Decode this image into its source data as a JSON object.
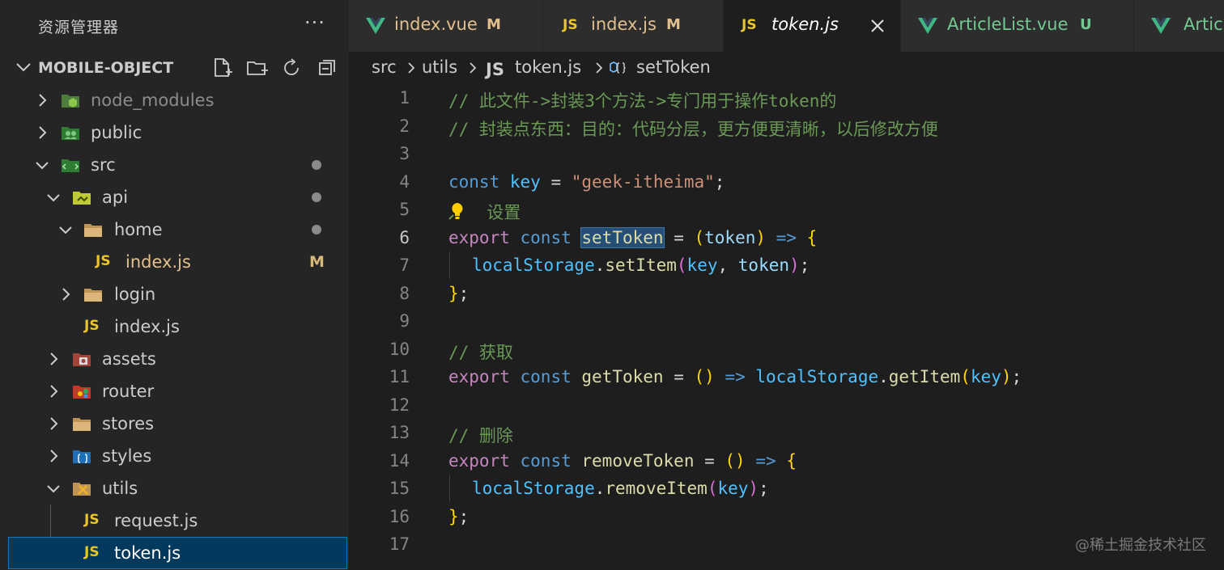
{
  "explorer": {
    "title": "资源管理器",
    "more": "···",
    "project": "MOBILE-OBJECT",
    "tree": [
      {
        "label": "node_modules",
        "depth": 1,
        "expanded": false,
        "icon": "node-folder-icon"
      },
      {
        "label": "public",
        "depth": 1,
        "expanded": false,
        "icon": "public-folder-icon"
      },
      {
        "label": "src",
        "depth": 1,
        "expanded": true,
        "icon": "src-folder-icon",
        "dot": true
      },
      {
        "label": "api",
        "depth": 2,
        "expanded": true,
        "icon": "api-folder-icon",
        "dot": true
      },
      {
        "label": "home",
        "depth": 3,
        "expanded": true,
        "icon": "folder-icon",
        "dot": true
      },
      {
        "label": "index.js",
        "depth": 4,
        "icon": "js-file-icon",
        "badge": "M"
      },
      {
        "label": "login",
        "depth": 3,
        "expanded": false,
        "icon": "folder-icon"
      },
      {
        "label": "index.js",
        "depth": 3,
        "icon": "js-file-icon"
      },
      {
        "label": "assets",
        "depth": 2,
        "expanded": false,
        "icon": "assets-folder-icon"
      },
      {
        "label": "router",
        "depth": 2,
        "expanded": false,
        "icon": "router-folder-icon"
      },
      {
        "label": "stores",
        "depth": 2,
        "expanded": false,
        "icon": "folder-icon"
      },
      {
        "label": "styles",
        "depth": 2,
        "expanded": false,
        "icon": "styles-folder-icon"
      },
      {
        "label": "utils",
        "depth": 2,
        "expanded": true,
        "icon": "utils-folder-icon"
      },
      {
        "label": "request.js",
        "depth": 3,
        "icon": "js-file-icon"
      },
      {
        "label": "token.js",
        "depth": 3,
        "icon": "js-file-icon",
        "selected": true
      }
    ]
  },
  "tabs": [
    {
      "label": "index.vue",
      "icon": "vue-icon",
      "badge": "M"
    },
    {
      "label": "index.js",
      "icon": "js-icon",
      "badge": "M"
    },
    {
      "label": "token.js",
      "icon": "js-icon",
      "active": true
    },
    {
      "label": "ArticleList.vue",
      "icon": "vue-icon",
      "badge": "U"
    },
    {
      "label": "Artic",
      "icon": "vue-icon"
    }
  ],
  "breadcrumb": {
    "parts": [
      "src",
      "utils",
      "token.js",
      "setToken"
    ],
    "js_icon": "JS"
  },
  "code": {
    "line_numbers": [
      "1",
      "2",
      "3",
      "4",
      "5",
      "6",
      "7",
      "8",
      "9",
      "10",
      "11",
      "12",
      "13",
      "14",
      "15",
      "16",
      "17"
    ],
    "current_line": "6",
    "line1": "// 此文件->封装3个方法->专门用于操作token的",
    "line2": "// 封装点东西：目的：代码分层，更方便更清晰，以后修改方便",
    "line4": {
      "const": "const",
      "key": "key",
      "eq": " = ",
      "str": "\"geek-itheima\"",
      "semi": ";"
    },
    "line5": {
      "comment": "设置"
    },
    "line6": {
      "export": "export",
      "const": "const",
      "name": "setToken",
      "eq": " = ",
      "open": "(",
      "param": "token",
      "close": ")",
      "arrow": "=>",
      "brace": "{"
    },
    "line7": {
      "obj": "localStorage",
      "dot": ".",
      "fn": "setItem",
      "open": "(",
      "a1": "key",
      "comma": ", ",
      "a2": "token",
      "close": ")",
      "semi": ";"
    },
    "line8": {
      "brace": "}",
      "semi": ";"
    },
    "line10": "// 获取",
    "line11": {
      "export": "export",
      "const": "const",
      "name": "getToken",
      "eq": " = ",
      "parens": "()",
      "arrow": "=>",
      "obj": "localStorage",
      "dot": ".",
      "fn": "getItem",
      "open": "(",
      "a1": "key",
      "close": ")",
      "semi": ";"
    },
    "line13": "// 删除",
    "line14": {
      "export": "export",
      "const": "const",
      "name": "removeToken",
      "eq": " = ",
      "parens": "()",
      "arrow": "=>",
      "brace": "{"
    },
    "line15": {
      "obj": "localStorage",
      "dot": ".",
      "fn": "removeItem",
      "open": "(",
      "a1": "key",
      "close": ")",
      "semi": ";"
    },
    "line16": {
      "brace": "}",
      "semi": ";"
    }
  },
  "watermark": "@稀土掘金技术社区"
}
